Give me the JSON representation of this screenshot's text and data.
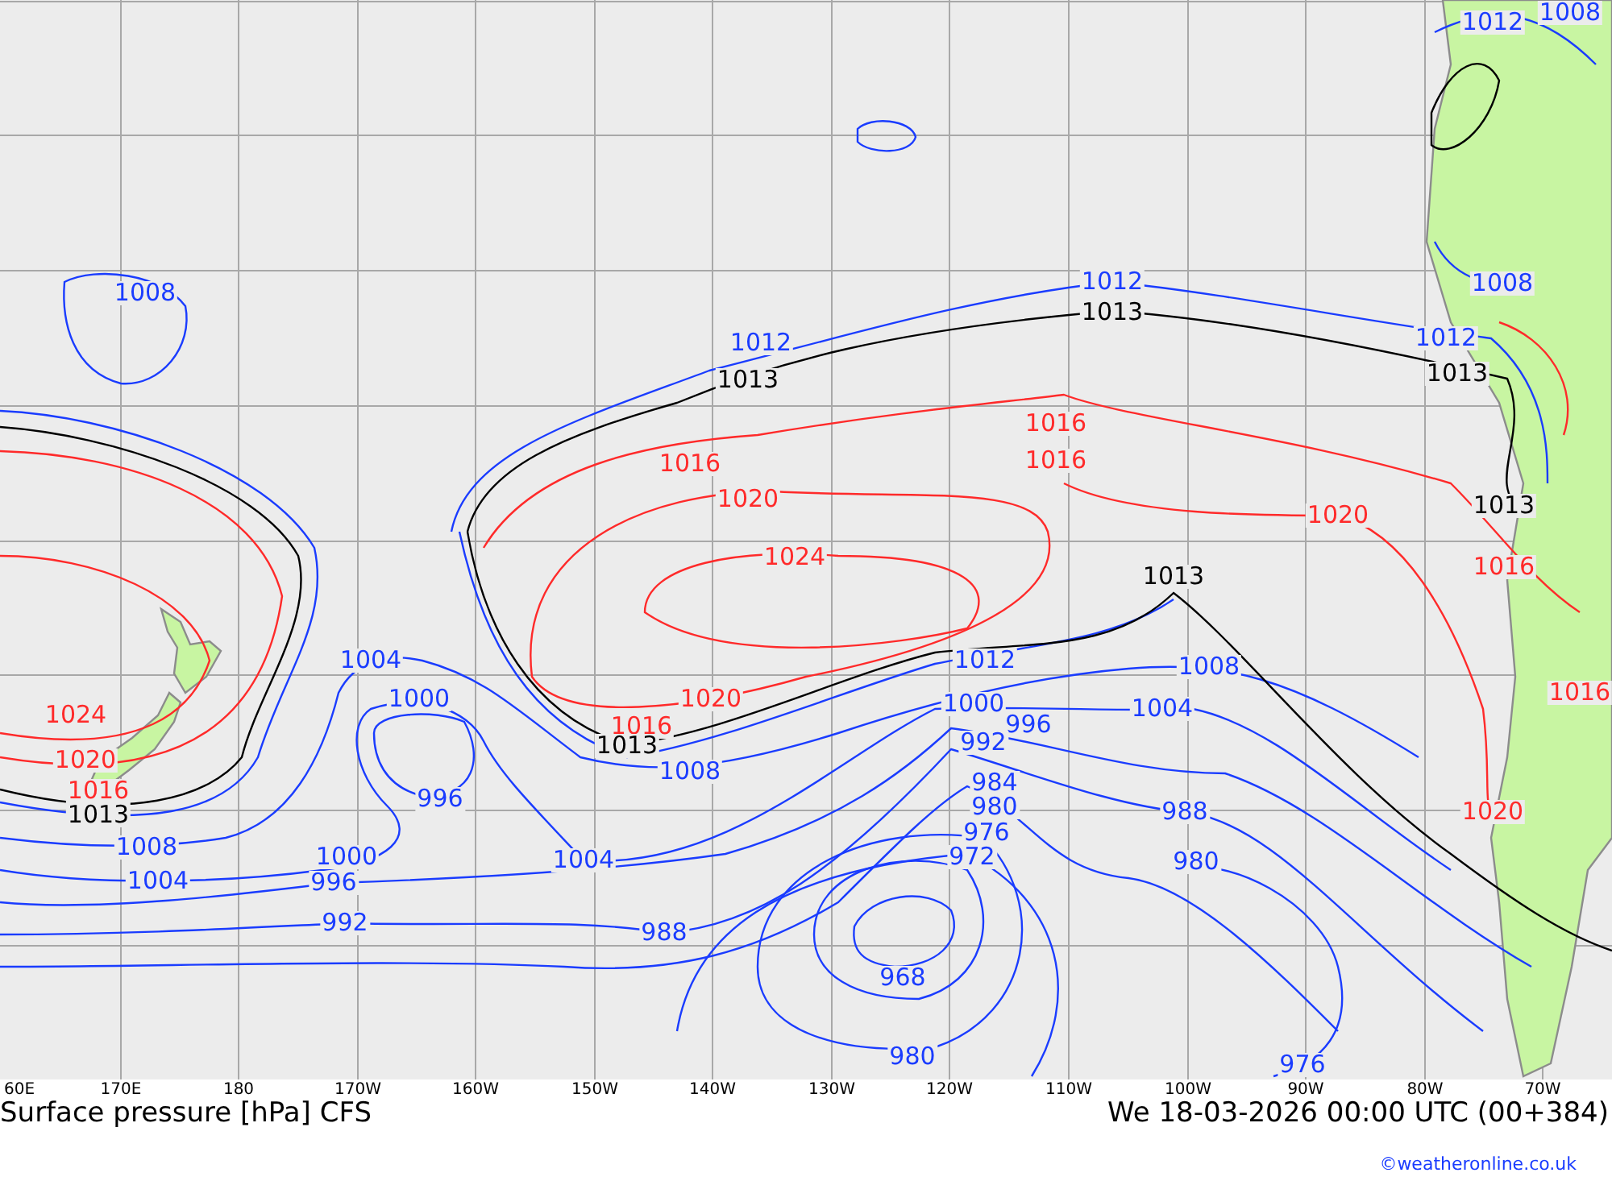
{
  "map": {
    "isobar_labels": [
      {
        "text": "1012",
        "kind": "low"
      },
      {
        "text": "1008",
        "kind": "low"
      },
      {
        "text": "1008",
        "kind": "low"
      },
      {
        "text": "1012",
        "kind": "low"
      },
      {
        "text": "1013",
        "kind": "standard"
      },
      {
        "text": "1012",
        "kind": "low"
      },
      {
        "text": "1012",
        "kind": "low"
      },
      {
        "text": "1008",
        "kind": "low"
      },
      {
        "text": "1013",
        "kind": "standard"
      },
      {
        "text": "1013",
        "kind": "standard"
      },
      {
        "text": "1016",
        "kind": "high"
      },
      {
        "text": "1016",
        "kind": "high"
      },
      {
        "text": "1016",
        "kind": "high"
      },
      {
        "text": "1020",
        "kind": "high"
      },
      {
        "text": "1020",
        "kind": "high"
      },
      {
        "text": "1013",
        "kind": "standard"
      },
      {
        "text": "1024",
        "kind": "high"
      },
      {
        "text": "1016",
        "kind": "high"
      },
      {
        "text": "1013",
        "kind": "standard"
      },
      {
        "text": "1004",
        "kind": "low"
      },
      {
        "text": "1012",
        "kind": "low"
      },
      {
        "text": "1008",
        "kind": "low"
      },
      {
        "text": "1000",
        "kind": "low"
      },
      {
        "text": "1020",
        "kind": "high"
      },
      {
        "text": "1000",
        "kind": "low"
      },
      {
        "text": "1004",
        "kind": "low"
      },
      {
        "text": "1016",
        "kind": "high"
      },
      {
        "text": "1024",
        "kind": "high"
      },
      {
        "text": "1016",
        "kind": "high"
      },
      {
        "text": "1013",
        "kind": "standard"
      },
      {
        "text": "996",
        "kind": "low"
      },
      {
        "text": "992",
        "kind": "low"
      },
      {
        "text": "1020",
        "kind": "high"
      },
      {
        "text": "1008",
        "kind": "low"
      },
      {
        "text": "984",
        "kind": "low"
      },
      {
        "text": "1016",
        "kind": "high"
      },
      {
        "text": "1013",
        "kind": "standard"
      },
      {
        "text": "996",
        "kind": "low"
      },
      {
        "text": "980",
        "kind": "low"
      },
      {
        "text": "988",
        "kind": "low"
      },
      {
        "text": "1020",
        "kind": "high"
      },
      {
        "text": "1008",
        "kind": "low"
      },
      {
        "text": "1000",
        "kind": "low"
      },
      {
        "text": "1004",
        "kind": "low"
      },
      {
        "text": "976",
        "kind": "low"
      },
      {
        "text": "972",
        "kind": "low"
      },
      {
        "text": "980",
        "kind": "low"
      },
      {
        "text": "1004",
        "kind": "low"
      },
      {
        "text": "996",
        "kind": "low"
      },
      {
        "text": "992",
        "kind": "low"
      },
      {
        "text": "988",
        "kind": "low"
      },
      {
        "text": "968",
        "kind": "low"
      },
      {
        "text": "980",
        "kind": "low"
      },
      {
        "text": "976",
        "kind": "low"
      }
    ],
    "longitude_labels": [
      "60E",
      "170E",
      "180",
      "170W",
      "160W",
      "150W",
      "140W",
      "130W",
      "120W",
      "110W",
      "100W",
      "90W",
      "80W",
      "70W"
    ]
  },
  "caption": {
    "title": "Surface pressure [hPa] CFS",
    "valid_time": "We 18-03-2026 00:00 UTC (00+384)"
  },
  "credit": "©weatheronline.co.uk"
}
